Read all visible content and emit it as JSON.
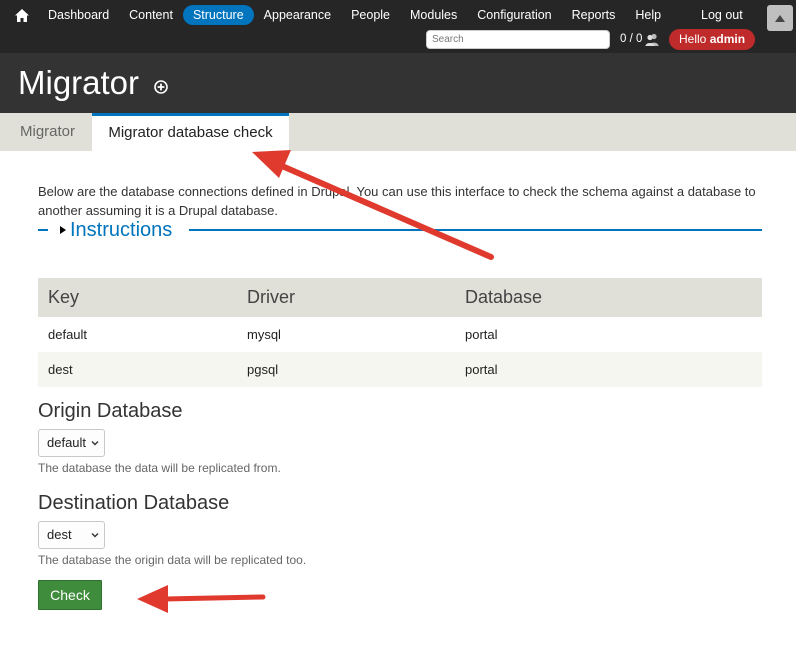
{
  "toolbar": {
    "home_icon": "home-icon",
    "nav": [
      {
        "label": "Dashboard",
        "active": false
      },
      {
        "label": "Content",
        "active": false
      },
      {
        "label": "Structure",
        "active": true
      },
      {
        "label": "Appearance",
        "active": false
      },
      {
        "label": "People",
        "active": false
      },
      {
        "label": "Modules",
        "active": false
      },
      {
        "label": "Configuration",
        "active": false
      },
      {
        "label": "Reports",
        "active": false
      },
      {
        "label": "Help",
        "active": false
      }
    ],
    "logout_label": "Log out",
    "search_placeholder": "Search",
    "user_counter": "0 / 0",
    "hello_prefix": "Hello",
    "hello_user": "admin",
    "accent_color": "#0074bd",
    "hello_color": "#bf2a2a"
  },
  "header": {
    "title": "Migrator"
  },
  "tabs": [
    {
      "label": "Migrator",
      "active": false
    },
    {
      "label": "Migrator database check",
      "active": true
    }
  ],
  "main": {
    "description": "Below are the database connections defined in Drupal. You can use this interface to check the schema against a database to another assuming it is a Drupal database.",
    "instructions_label": "Instructions",
    "table": {
      "headers": [
        "Key",
        "Driver",
        "Database"
      ],
      "rows": [
        [
          "default",
          "mysql",
          "portal"
        ],
        [
          "dest",
          "pgsql",
          "portal"
        ]
      ]
    },
    "origin": {
      "label": "Origin Database",
      "selected": "default",
      "description": "The database the data will be replicated from."
    },
    "destination": {
      "label": "Destination Database",
      "selected": "dest",
      "description": "The database the origin data will be replicated too."
    },
    "check_button": "Check",
    "button_color": "#3f8c3c"
  },
  "annotation_color": "#e03a2f"
}
